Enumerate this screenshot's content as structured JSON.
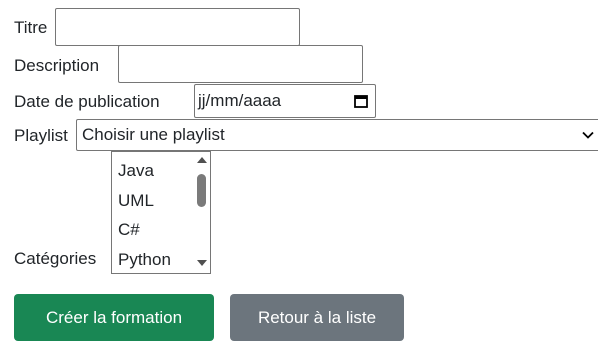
{
  "form": {
    "titre": {
      "label": "Titre",
      "value": ""
    },
    "description": {
      "label": "Description",
      "value": ""
    },
    "date": {
      "label": "Date de publication",
      "display": "jj/mm/aaaa",
      "icon": "calendar-icon"
    },
    "playlist": {
      "label": "Playlist",
      "selected": "Choisir une playlist",
      "icon": "chevron-down-icon"
    },
    "categories": {
      "label": "Catégories",
      "options": [
        "Java",
        "UML",
        "C#",
        "Python"
      ]
    }
  },
  "buttons": {
    "create_label": "Créer la formation",
    "back_label": "Retour à la liste"
  },
  "colors": {
    "success": "#198754",
    "secondary": "#6c757d",
    "text": "#212529",
    "border": "#767676"
  }
}
